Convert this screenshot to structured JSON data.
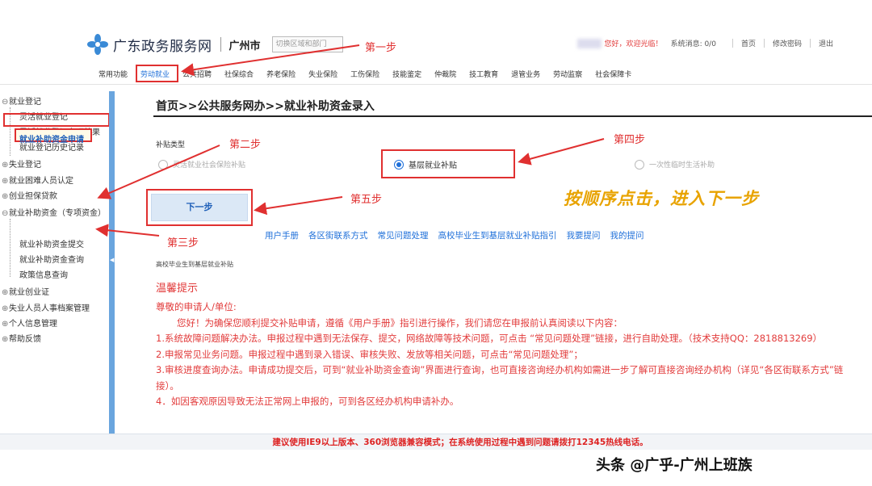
{
  "header": {
    "site_name": "广东政务服务网",
    "city": "广州市",
    "region_placeholder": "切换区域和部门",
    "welcome": "您好，欢迎光临！",
    "system_msg": "系统消息: 0/0",
    "home": "首页",
    "change_password": "修改密码",
    "logout": "退出"
  },
  "nav": {
    "items": [
      "常用功能",
      "劳动就业",
      "公共招聘",
      "社保综合",
      "养老保险",
      "失业保险",
      "工伤保险",
      "技能鉴定",
      "仲裁院",
      "技工教育",
      "退管业务",
      "劳动监察",
      "社会保障卡"
    ],
    "active_index": 1
  },
  "sidebar": {
    "items": [
      {
        "label": "就业登记",
        "sign": "⊖"
      },
      {
        "label": "灵活就业登记"
      },
      {
        "label": "灵活就业登记办理结果"
      },
      {
        "label": "就业登记历史记录"
      },
      {
        "label": "失业登记",
        "sign": "⊕"
      },
      {
        "label": "就业困难人员认定",
        "sign": "⊕"
      },
      {
        "label": "创业担保贷款",
        "sign": "⊕"
      },
      {
        "label": "就业补助资金（专项资金）",
        "sign": "⊖"
      },
      {
        "label": "就业补助资金申请"
      },
      {
        "label": "就业补助资金提交"
      },
      {
        "label": "就业补助资金查询"
      },
      {
        "label": "政策信息查询"
      },
      {
        "label": "就业创业证",
        "sign": "⊕"
      },
      {
        "label": "失业人员人事档案管理",
        "sign": "⊕"
      },
      {
        "label": "个人信息管理",
        "sign": "⊕"
      },
      {
        "label": "帮助反馈",
        "sign": "⊕"
      }
    ]
  },
  "main": {
    "breadcrumb": "首页>>公共服务网办>>就业补助资金录入",
    "subsidy_type_label": "补贴类型",
    "options": [
      {
        "label": "灵活就业社会保险补贴",
        "checked": false
      },
      {
        "label": "基层就业补贴",
        "checked": true
      },
      {
        "label": "一次性临时生活补助",
        "checked": false
      }
    ],
    "next_button": "下一步",
    "links": [
      "用户手册",
      "各区街联系方式",
      "常见问题处理",
      "高校毕业生到基层就业补贴指引",
      "我要提问",
      "我的提问"
    ],
    "section_small_title": "高校毕业生到基层就业补贴",
    "warm_tip_title": "温馨提示",
    "tips": [
      "尊敬的申请人/单位:",
      "您好！为确保您顺利提交补贴申请，遵循《用户手册》指引进行操作，我们请您在申报前认真阅读以下内容：",
      "1.系统故障问题解决办法。申报过程中遇到无法保存、提交，网络故障等技术问题，可点击 “常见问题处理”链接，进行自助处理。（技术支持QQ：2818813269）",
      "2.申报常见业务问题。申报过程中遇到录入错误、审核失败、发放等相关问题，可点击“常见问题处理”；",
      "3.审核进度查询办法。申请成功提交后，可到“就业补助资金查询”界面进行查询，也可直接咨询经办机构如需进一步了解可直接咨询经办机构（详见“各区街联系方式”链接）。",
      "4．如因客观原因导致无法正常网上申报的，可到各区经办机构申请补办。"
    ]
  },
  "footer": {
    "notice": "建议使用IE9以上版本、360浏览器兼容模式；在系统使用过程中遇到问题请拨打12345热线电话。"
  },
  "annotations": {
    "step1": "第一步",
    "step2": "第二步",
    "step3": "第三步",
    "step4": "第四步",
    "step5": "第五步",
    "hint": "按顺序点击，进入下一步",
    "watermark": "头条 @广乎-广州上班族"
  },
  "colors": {
    "annotation_red": "#e03030",
    "link_blue": "#1e6fd9",
    "tip_red": "#e23b3b",
    "hint_orange": "#e8a300",
    "sidebar_bar": "#6aa5de"
  }
}
